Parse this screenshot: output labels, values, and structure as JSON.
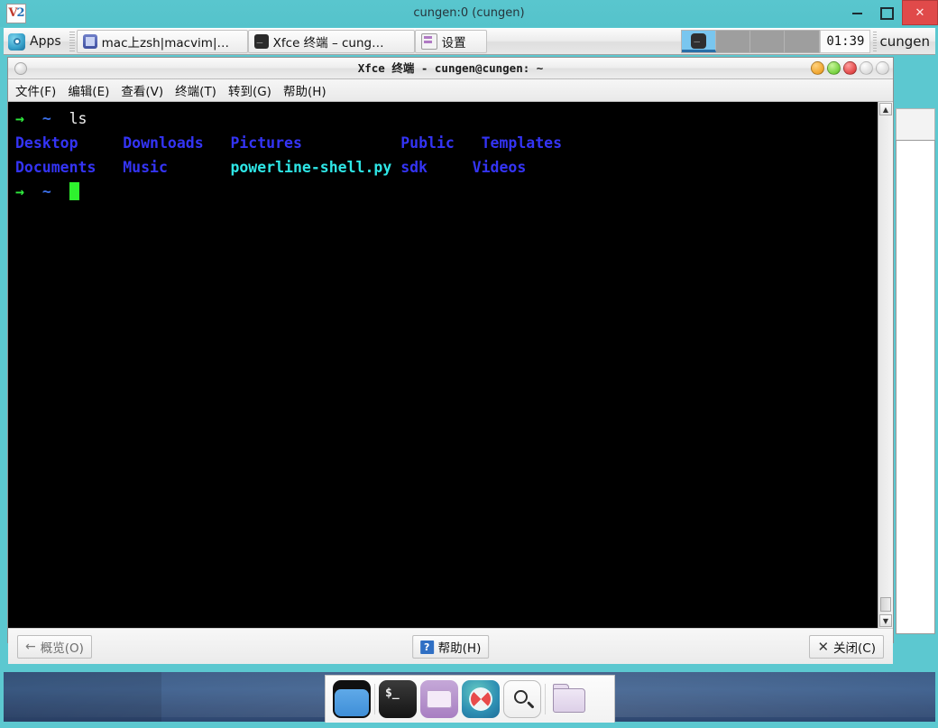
{
  "vnc_window": {
    "title": "cungen:0 (cungen)",
    "app_icon_label": "V2",
    "controls": {
      "minimize": "–",
      "maximize": "□",
      "close": "✕"
    }
  },
  "panel": {
    "apps_button": {
      "label": "Apps",
      "icon": "apps-icon"
    },
    "tasks": [
      {
        "label": "mac上zsh|macvim|…",
        "icon": "vim-icon"
      },
      {
        "label": "Xfce 终端 – cung…",
        "icon": "terminal-icon"
      },
      {
        "label": "设置",
        "icon": "settings-icon"
      }
    ],
    "workspaces": [
      {
        "name": "workspace-1",
        "active": true
      },
      {
        "name": "workspace-2",
        "active": false
      },
      {
        "name": "workspace-3",
        "active": false
      },
      {
        "name": "workspace-4",
        "active": false
      }
    ],
    "clock": "01:39",
    "username": "cungen"
  },
  "terminal_window": {
    "title": "Xfce 终端 - cungen@cungen: ~",
    "menus": [
      {
        "text": "文件(F)",
        "plain": "文件",
        "accel": "F"
      },
      {
        "text": "编辑(E)",
        "plain": "编辑",
        "accel": "E"
      },
      {
        "text": "查看(V)",
        "plain": "查看",
        "accel": "V"
      },
      {
        "text": "终端(T)",
        "plain": "终端",
        "accel": "T"
      },
      {
        "text": "转到(G)",
        "plain": "转到",
        "accel": "G"
      },
      {
        "text": "帮助(H)",
        "plain": "帮助",
        "accel": "H"
      }
    ],
    "titlebar_buttons": [
      "minimize",
      "maximize",
      "close",
      "shade",
      "extra"
    ],
    "content": {
      "prompt_arrow": "→",
      "prompt_path": "~",
      "command": "ls",
      "listing_row_1": [
        "Desktop",
        "Downloads",
        "Pictures",
        "Public",
        "Templates"
      ],
      "listing_row_2": [
        "Documents",
        "Music",
        "powerline-shell.py",
        "sdk",
        "Videos"
      ],
      "file_entry": "powerline-shell.py",
      "line1_plain": "→  ~  ls",
      "line2_plain": "Desktop     Downloads   Pictures          Public   Templates",
      "line3_plain": "Documents   Music       powerline-shell.py  sdk     Videos",
      "line4_plain": "→  ~"
    },
    "colors": {
      "background": "#000000",
      "directory": "#3434f5",
      "executable_file": "#2ee6e6",
      "prompt_arrow": "#2ee83d",
      "prompt_path": "#3b6fe8",
      "cursor": "#2ef32e",
      "command_text": "#f2f2f2"
    },
    "statusbar": {
      "overview": "概览(O)",
      "help": "帮助(H)",
      "close": "关闭(C)",
      "help_badge": "?",
      "overview_glyph": "←",
      "close_glyph": "✕"
    }
  },
  "dock": {
    "items": [
      {
        "name": "finder-icon",
        "label": "Finder"
      },
      {
        "name": "terminal-icon",
        "label": "Terminal"
      },
      {
        "name": "folder-purple-icon",
        "label": "Folder"
      },
      {
        "name": "safari-compass-icon",
        "label": "Safari"
      },
      {
        "name": "search-magnifier-icon",
        "label": "Search"
      },
      {
        "name": "files-folder-icon",
        "label": "Files"
      }
    ]
  },
  "theme": {
    "vnc_chrome": "#5cc8d0",
    "panel_bg": "#ececec",
    "desktop_wallpaper": "#3b5b86",
    "close_button_red": "#e04a4a"
  }
}
